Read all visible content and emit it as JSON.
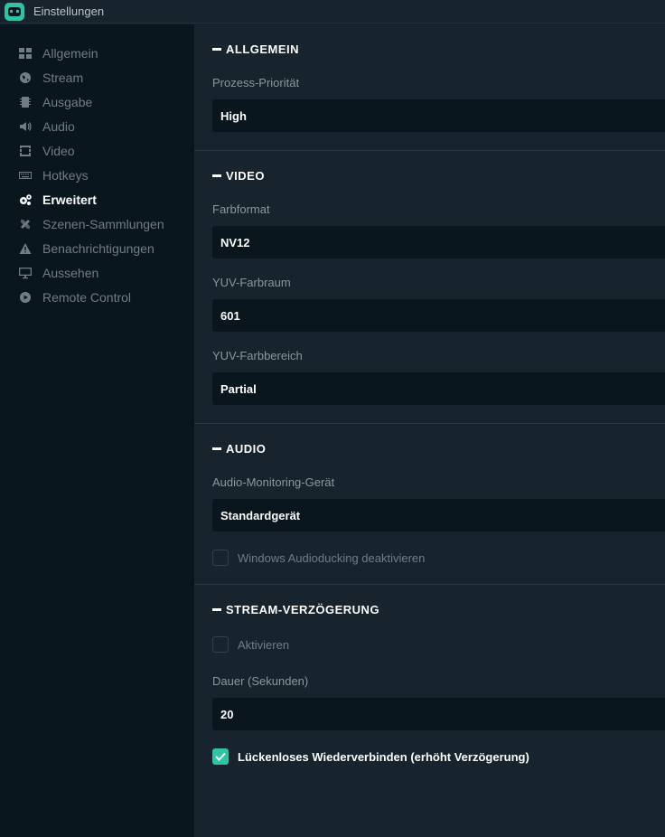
{
  "window": {
    "title": "Einstellungen"
  },
  "sidebar": {
    "items": [
      {
        "label": "Allgemein",
        "icon": "grid-icon",
        "active": false
      },
      {
        "label": "Stream",
        "icon": "globe-icon",
        "active": false
      },
      {
        "label": "Ausgabe",
        "icon": "chip-icon",
        "active": false
      },
      {
        "label": "Audio",
        "icon": "speaker-icon",
        "active": false
      },
      {
        "label": "Video",
        "icon": "film-icon",
        "active": false
      },
      {
        "label": "Hotkeys",
        "icon": "keyboard-icon",
        "active": false
      },
      {
        "label": "Erweitert",
        "icon": "gears-icon",
        "active": true
      },
      {
        "label": "Szenen-Sammlungen",
        "icon": "tools-icon",
        "active": false
      },
      {
        "label": "Benachrichtigungen",
        "icon": "warning-icon",
        "active": false
      },
      {
        "label": "Aussehen",
        "icon": "monitor-icon",
        "active": false
      },
      {
        "label": "Remote Control",
        "icon": "play-circle-icon",
        "active": false
      }
    ]
  },
  "sections": {
    "general": {
      "title": "ALLGEMEIN",
      "priority_label": "Prozess-Priorität",
      "priority_value": "High"
    },
    "video": {
      "title": "VIDEO",
      "color_format_label": "Farbformat",
      "color_format_value": "NV12",
      "yuv_space_label": "YUV-Farbraum",
      "yuv_space_value": "601",
      "yuv_range_label": "YUV-Farbbereich",
      "yuv_range_value": "Partial"
    },
    "audio": {
      "title": "AUDIO",
      "monitoring_label": "Audio-Monitoring-Gerät",
      "monitoring_value": "Standardgerät",
      "ducking_label": "Windows Audioducking deaktivieren",
      "ducking_checked": false
    },
    "delay": {
      "title": "STREAM-VERZÖGERUNG",
      "enable_label": "Aktivieren",
      "enable_checked": false,
      "duration_label": "Dauer (Sekunden)",
      "duration_value": "20",
      "reconnect_label": "Lückenloses Wiederverbinden (erhöht Verzögerung)",
      "reconnect_checked": true
    }
  },
  "colors": {
    "accent": "#31c3a2",
    "sidebar_bg": "#09161d",
    "content_bg": "#17242d"
  }
}
